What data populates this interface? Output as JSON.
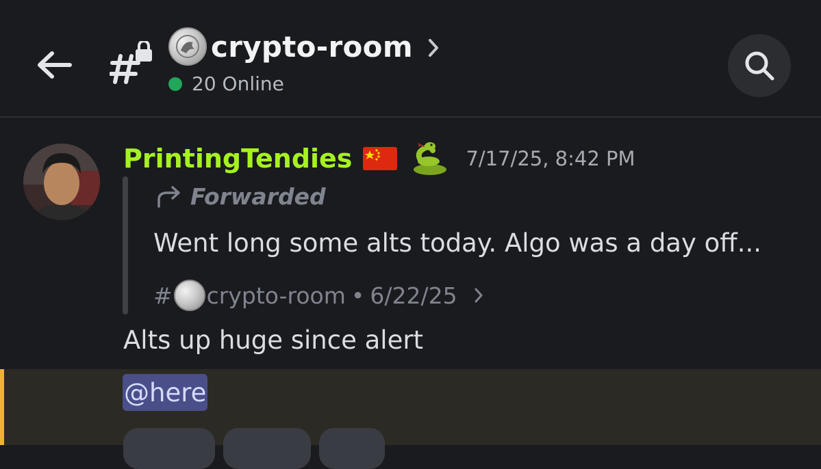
{
  "header": {
    "channel_name": "crypto-room",
    "online_text": "20 Online"
  },
  "message": {
    "username": "PrintingTendies",
    "timestamp": "7/17/25, 8:42 PM",
    "forwarded_label": "Forwarded",
    "forwarded_content": "Went long some alts today. Algo was a day off...",
    "forwarded_source_hash": "#",
    "forwarded_source_channel": "crypto-room",
    "forwarded_source_sep": "•",
    "forwarded_source_date": "6/22/25",
    "body": "Alts up huge since alert",
    "mention": "@here"
  },
  "colors": {
    "username": "#a6f220",
    "online": "#23a55a",
    "mention_bg": "#4a4f8a",
    "mention_accent": "#f0b232"
  }
}
